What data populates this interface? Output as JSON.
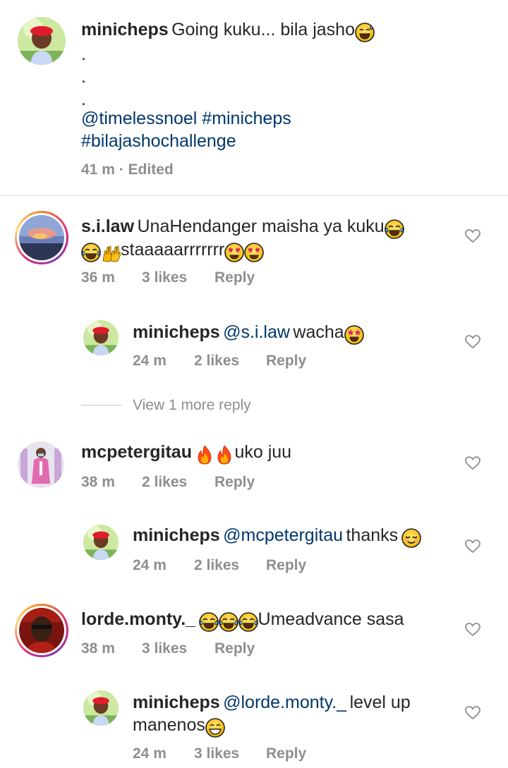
{
  "caption": {
    "username": "minicheps",
    "text": "Going kuku... bila jasho",
    "dots": ".",
    "hashtags_line1": "@timelessnoel #minicheps",
    "hashtags_line2": "#bilajashochallenge",
    "meta": "41 m · Edited"
  },
  "comments": [
    {
      "username": "s.i.law",
      "text_line1": "UnaHendanger maisha ya kuku",
      "text_line2": "staaaaarrrrrrr",
      "time": "36 m",
      "likes": "3 likes",
      "reply": "Reply",
      "replies": [
        {
          "username": "minicheps",
          "mention": "@s.i.law",
          "text": "wacha",
          "time": "24 m",
          "likes": "2 likes",
          "reply": "Reply"
        }
      ],
      "view_more": "View 1 more reply"
    },
    {
      "username": "mcpetergitau",
      "text_line1": "uko juu",
      "time": "38 m",
      "likes": "2 likes",
      "reply": "Reply",
      "replies": [
        {
          "username": "minicheps",
          "mention": "@mcpetergitau",
          "text": "thanks",
          "time": "24 m",
          "likes": "2 likes",
          "reply": "Reply"
        }
      ]
    },
    {
      "username": "lorde.monty._",
      "text_line1": "Umeadvance sasa",
      "time": "38 m",
      "likes": "3 likes",
      "reply": "Reply",
      "replies": [
        {
          "username": "minicheps",
          "mention": "@lorde.monty._",
          "text": "level up",
          "text_line2": "manenos",
          "time": "24 m",
          "likes": "3 likes",
          "reply": "Reply"
        }
      ]
    }
  ],
  "colors": {
    "text": "#262626",
    "meta": "#8e8e8e",
    "mention": "#00376b",
    "divider": "#dbdbdb"
  },
  "icons": [
    "heart-icon",
    "grinning-sweat-emoji",
    "tears-of-joy-emoji",
    "raising-hands-emoji",
    "heart-eyes-emoji",
    "star-struck-emoji",
    "fire-emoji",
    "smiling-relieved-emoji",
    "grinning-emoji"
  ]
}
